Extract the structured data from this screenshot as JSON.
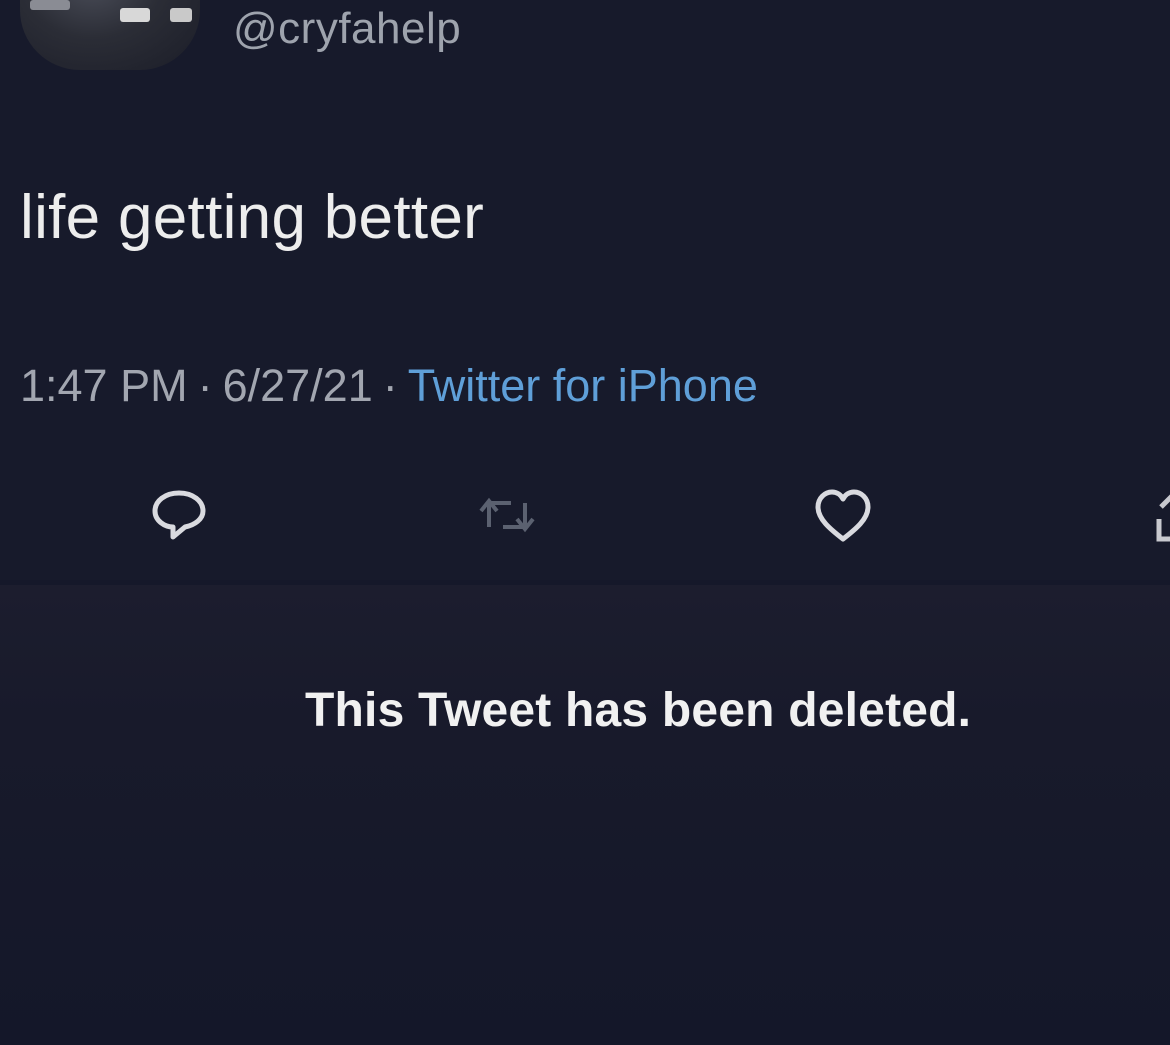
{
  "tweet": {
    "handle": "@cryfahelp",
    "text": "life getting better",
    "time": "1:47 PM",
    "date": "6/27/21",
    "separator": "·",
    "source": "Twitter for iPhone",
    "actions": [
      {
        "name": "reply",
        "icon": "speech-bubble-icon"
      },
      {
        "name": "retweet",
        "icon": "retweet-icon"
      },
      {
        "name": "like",
        "icon": "heart-icon"
      },
      {
        "name": "share",
        "icon": "share-icon"
      }
    ]
  },
  "deleted_notice": {
    "text": "This Tweet has been deleted."
  },
  "colors": {
    "background": "#171a2b",
    "text": "#ededed",
    "muted": "#a2a6b0",
    "link": "#5f9fd8"
  }
}
